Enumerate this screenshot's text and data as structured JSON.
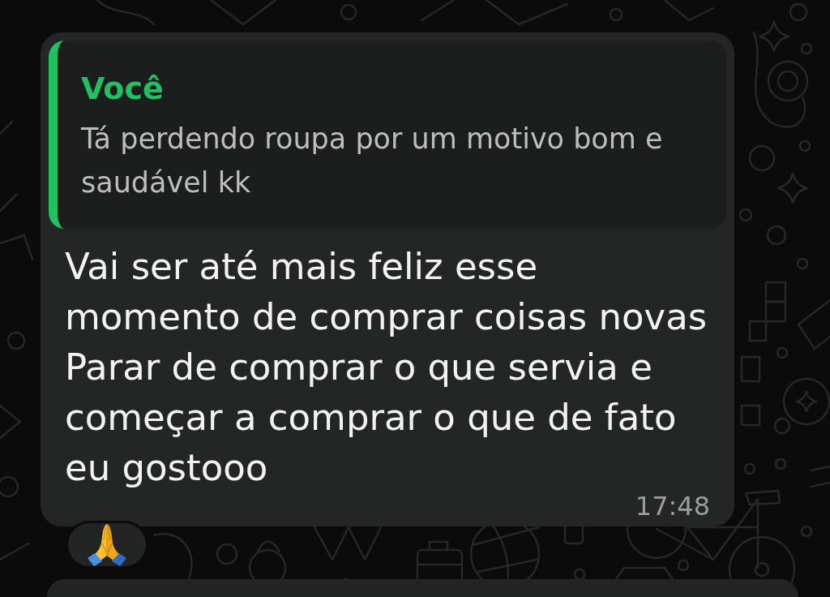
{
  "message": {
    "quote": {
      "author": "Você",
      "text": "Tá perdendo roupa por um motivo bom e saudável kk"
    },
    "text": "Vai ser até mais feliz esse momento de comprar coisas novas\nParar de comprar o que servia e começar a comprar o que de fato eu gostooo",
    "time": "17:48"
  }
}
